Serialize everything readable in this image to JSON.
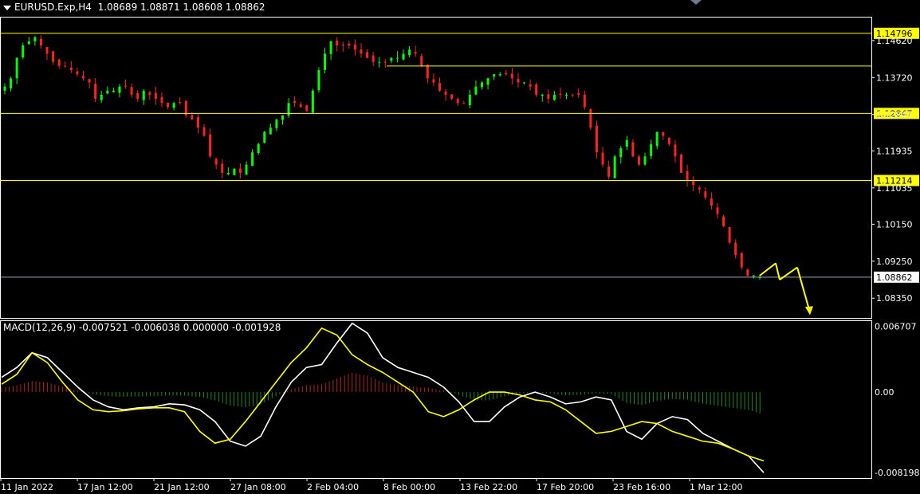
{
  "window": {
    "symbol_title": "EURUSD.Exp,H4",
    "ohlc": "1.08689 1.08871 1.08608 1.08862"
  },
  "macd_title": "MACD(12,26,9) -0.007521 -0.006038 0.000000 -0.001928",
  "chart_data": [
    {
      "type": "candlestick",
      "title": "EURUSD.Exp,H4",
      "price_ticks": [
        "1.14620",
        "1.13720",
        "1.12847",
        "1.11935",
        "1.11035",
        "1.10150",
        "1.09250",
        "1.08350"
      ],
      "price_tick_values": [
        1.1462,
        1.1372,
        1.1282,
        1.11935,
        1.11035,
        1.1015,
        1.0925,
        1.0835
      ],
      "ylim": [
        1.0787,
        1.1518
      ],
      "horizontal_levels": [
        {
          "label": "1.14796",
          "value": 1.14796,
          "color": "#ffff00",
          "highlight": true,
          "from_start": true
        },
        {
          "label": "",
          "value": 1.14,
          "color": "#ffff00",
          "highlight": false,
          "from_start": false
        },
        {
          "label": "1.12847",
          "value": 1.12847,
          "color": "#ffff00",
          "highlight": true,
          "from_start": true
        },
        {
          "label": "1.11214",
          "value": 1.11214,
          "color": "#ffff00",
          "highlight": true,
          "from_start": true
        }
      ],
      "current_price": {
        "label": "1.08862",
        "value": 1.08862,
        "color": "#a0a8b8"
      },
      "x_labels": [
        "11 Jan 2022",
        "17 Jan 12:00",
        "21 Jan 12:00",
        "27 Jan 08:00",
        "2 Feb 04:00",
        "8 Feb 00:00",
        "13 Feb 22:00",
        "17 Feb 20:00",
        "23 Feb 16:00",
        "1 Mar 12:00"
      ],
      "series_close": [
        1.135,
        1.137,
        1.142,
        1.145,
        1.146,
        1.147,
        1.145,
        1.143,
        1.141,
        1.14,
        1.14,
        1.139,
        1.138,
        1.137,
        1.136,
        1.132,
        1.133,
        1.134,
        1.134,
        1.135,
        1.135,
        1.133,
        1.132,
        1.134,
        1.133,
        1.132,
        1.131,
        1.13,
        1.131,
        1.131,
        1.128,
        1.127,
        1.125,
        1.123,
        1.118,
        1.116,
        1.114,
        1.114,
        1.115,
        1.114,
        1.116,
        1.119,
        1.121,
        1.124,
        1.125,
        1.127,
        1.128,
        1.131,
        1.131,
        1.13,
        1.129,
        1.134,
        1.139,
        1.143,
        1.146,
        1.145,
        1.145,
        1.145,
        1.144,
        1.143,
        1.142,
        1.141,
        1.141,
        1.141,
        1.142,
        1.142,
        1.143,
        1.144,
        1.143,
        1.14,
        1.137,
        1.136,
        1.134,
        1.133,
        1.132,
        1.131,
        1.131,
        1.133,
        1.135,
        1.136,
        1.137,
        1.138,
        1.138,
        1.138,
        1.137,
        1.136,
        1.136,
        1.135,
        1.133,
        1.133,
        1.132,
        1.133,
        1.133,
        1.133,
        1.133,
        1.133,
        1.13,
        1.125,
        1.119,
        1.116,
        1.113,
        1.118,
        1.12,
        1.122,
        1.118,
        1.116,
        1.118,
        1.121,
        1.124,
        1.123,
        1.121,
        1.118,
        1.114,
        1.112,
        1.111,
        1.11,
        1.108,
        1.106,
        1.104,
        1.101,
        1.097,
        1.094,
        1.091,
        1.089,
        1.089,
        1.0886
      ],
      "macd": [
        0.0015,
        0.0025,
        0.004,
        0.0035,
        0.002,
        0.0005,
        -0.0008,
        -0.0015,
        -0.0018,
        -0.0016,
        -0.0015,
        -0.0012,
        -0.0013,
        -0.0018,
        -0.003,
        -0.005,
        -0.0055,
        -0.0045,
        -0.0015,
        0.001,
        0.0025,
        0.0028,
        0.005,
        0.007,
        0.006,
        0.0035,
        0.0025,
        0.002,
        0.0015,
        0.0005,
        -0.001,
        -0.003,
        -0.003,
        -0.0015,
        -0.0005,
        0.0,
        -0.0005,
        -0.0012,
        -0.001,
        -0.0005,
        -0.0008,
        -0.004,
        -0.0048,
        -0.0032,
        -0.0025,
        -0.0028,
        -0.0042,
        -0.005,
        -0.0058,
        -0.0065,
        -0.0082
      ],
      "macd_signal": [
        0.0008,
        0.0018,
        0.004,
        0.003,
        0.001,
        -0.0008,
        -0.0018,
        -0.002,
        -0.0019,
        -0.0017,
        -0.0016,
        -0.0016,
        -0.002,
        -0.004,
        -0.0052,
        -0.0048,
        -0.003,
        -0.001,
        0.001,
        0.003,
        0.0045,
        0.0065,
        0.0058,
        0.0038,
        0.0028,
        0.002,
        0.001,
        0.0,
        -0.002,
        -0.0025,
        -0.0018,
        -0.0008,
        0.0,
        0.0,
        -0.0003,
        -0.0008,
        -0.001,
        -0.0018,
        -0.003,
        -0.0042,
        -0.004,
        -0.0035,
        -0.003,
        -0.0032,
        -0.004,
        -0.0045,
        -0.005,
        -0.0052,
        -0.0058,
        -0.0065,
        -0.007
      ],
      "macd_ticks": [
        "0.006707",
        "0.00",
        "-0.008198"
      ],
      "macd_tick_values": [
        0.006707,
        0.0,
        -0.008198
      ],
      "macd_ylim": [
        -0.00875,
        0.0073
      ],
      "projection": [
        1.089,
        1.092,
        1.088,
        1.091,
        1.08
      ]
    }
  ]
}
